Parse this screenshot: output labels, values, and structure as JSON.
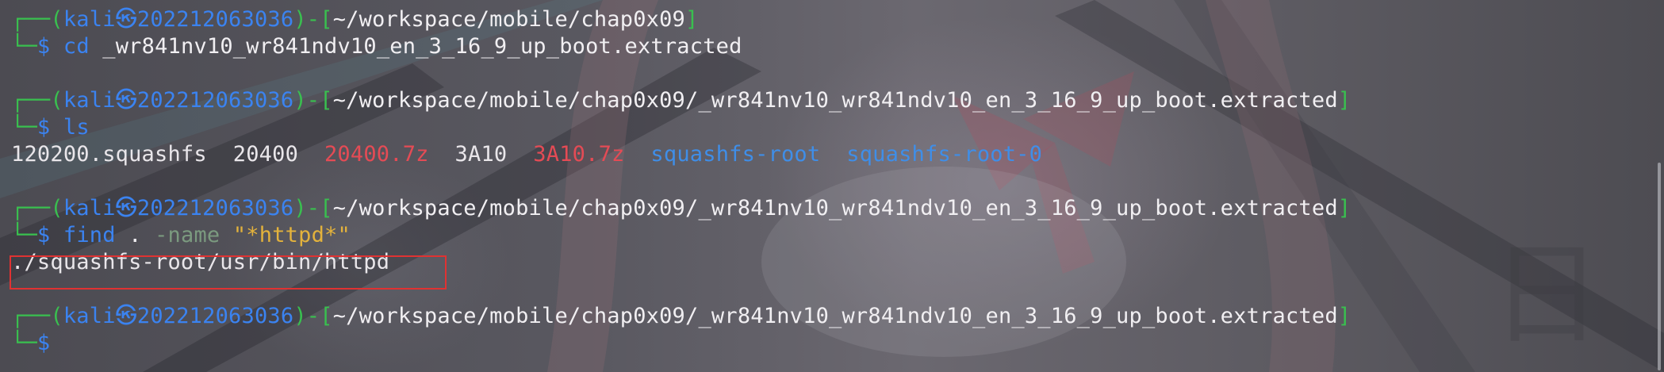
{
  "prompt": {
    "user": "kali",
    "at_icon": "skull-icon",
    "host": "202212063036",
    "open_bracket": "-[",
    "close_bracket": "]",
    "dollar": "$",
    "corner_top": "┌──(",
    "corner_mid": ")",
    "corner_bottom": "└─"
  },
  "blocks": [
    {
      "path": "~/workspace/mobile/chap0x09",
      "command": "cd",
      "args": "_wr841nv10_wr841ndv10_en_3_16_9_up_boot.extracted"
    },
    {
      "path": "~/workspace/mobile/chap0x09/_wr841nv10_wr841ndv10_en_3_16_9_up_boot.extracted",
      "command": "ls",
      "output": [
        {
          "text": "120200.squashfs",
          "kind": "file"
        },
        {
          "text": "20400",
          "kind": "file"
        },
        {
          "text": "20400.7z",
          "kind": "archive"
        },
        {
          "text": "3A10",
          "kind": "file"
        },
        {
          "text": "3A10.7z",
          "kind": "archive"
        },
        {
          "text": "squashfs-root",
          "kind": "directory"
        },
        {
          "text": "squashfs-root-0",
          "kind": "directory"
        }
      ]
    },
    {
      "path": "~/workspace/mobile/chap0x09/_wr841nv10_wr841ndv10_en_3_16_9_up_boot.extracted",
      "command": "find",
      "arg_dot": ".",
      "arg_flag": "-name",
      "arg_pattern": "\"*httpd*\"",
      "output_line": "./squashfs-root/usr/bin/httpd"
    },
    {
      "path": "~/workspace/mobile/chap0x09/_wr841nv10_wr841ndv10_en_3_16_9_up_boot.extracted"
    }
  ],
  "colors": {
    "prompt_frame": "#39c04f",
    "user_host": "#3b83f0",
    "archive": "#e44b55",
    "directory": "#3f8ee8",
    "string": "#e3b23c",
    "highlight_box": "#e03232"
  }
}
